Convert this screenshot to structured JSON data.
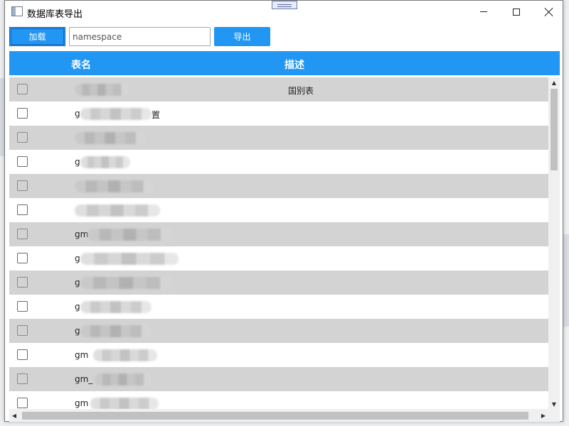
{
  "window": {
    "title": "数据库表导出",
    "minimize_icon": "minimize-icon",
    "maximize_icon": "maximize-icon",
    "close_icon": "close-icon"
  },
  "toolbar": {
    "load_label": "加载",
    "namespace_value": "namespace",
    "export_label": "导出"
  },
  "table": {
    "columns": {
      "name": "表名",
      "description": "描述"
    },
    "rows": [
      {
        "name": "",
        "description": "国别表"
      },
      {
        "name": "g",
        "suffix": "置",
        "description": ""
      },
      {
        "name": "",
        "description": ""
      },
      {
        "name": "g",
        "description": ""
      },
      {
        "name": "",
        "description": ""
      },
      {
        "name": "",
        "description": ""
      },
      {
        "name": "gm",
        "description": ""
      },
      {
        "name": "g",
        "description": ""
      },
      {
        "name": "g",
        "description": ""
      },
      {
        "name": "g",
        "description": ""
      },
      {
        "name": "g",
        "description": ""
      },
      {
        "name": "gm",
        "description": ""
      },
      {
        "name": "gm_",
        "description": ""
      },
      {
        "name": "gm",
        "description": ""
      }
    ]
  },
  "colors": {
    "accent": "#2196f3",
    "row_alt": "#d3d3d3",
    "row_bg": "#ffffff"
  }
}
